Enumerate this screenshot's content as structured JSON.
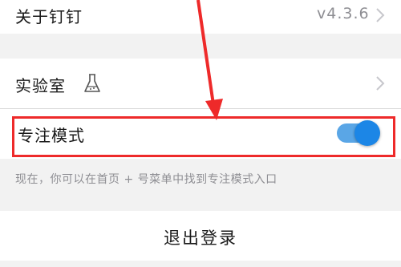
{
  "settings": {
    "about": {
      "label": "关于钉钉",
      "version": "v4.3.6"
    },
    "lab": {
      "label": "实验室",
      "icon": "flask-icon"
    },
    "focus_mode": {
      "label": "专注模式",
      "enabled": true
    },
    "focus_hint": "现在，你可以在首页 + 号菜单中找到专注模式入口",
    "logout_label": "退出登录"
  },
  "annotation": {
    "color": "#ee2a2a"
  }
}
